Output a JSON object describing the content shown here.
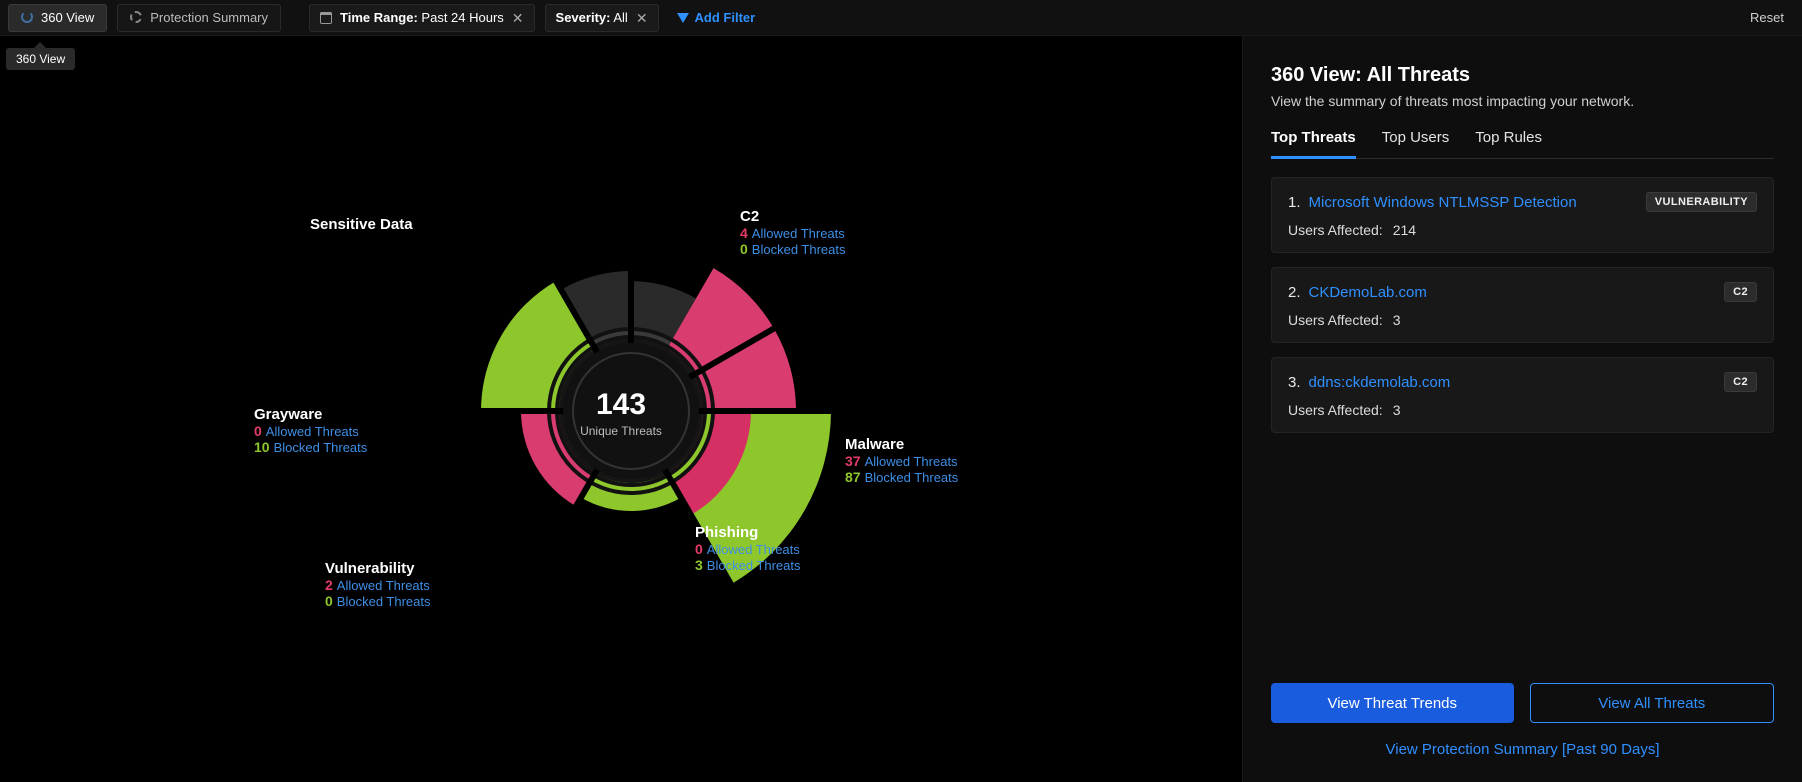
{
  "topbar": {
    "tabs": [
      {
        "label": "360 View",
        "active": true
      },
      {
        "label": "Protection Summary",
        "active": false
      }
    ],
    "filters": [
      {
        "prefix": "Time Range:",
        "value": "Past 24 Hours"
      },
      {
        "prefix": "Severity:",
        "value": "All"
      }
    ],
    "add_filter": "Add Filter",
    "reset": "Reset",
    "tooltip": "360 View"
  },
  "chart": {
    "center_value": "143",
    "center_label": "Unique Threats",
    "categories": {
      "sensitive": {
        "name": "Sensitive Data"
      },
      "c2": {
        "name": "C2",
        "allowed": "4",
        "blocked": "0"
      },
      "malware": {
        "name": "Malware",
        "allowed": "37",
        "blocked": "87"
      },
      "phishing": {
        "name": "Phishing",
        "allowed": "0",
        "blocked": "3"
      },
      "vulnerability": {
        "name": "Vulnerability",
        "allowed": "2",
        "blocked": "0"
      },
      "grayware": {
        "name": "Grayware",
        "allowed": "0",
        "blocked": "10"
      }
    },
    "labels": {
      "allowed": "Allowed Threats",
      "blocked": "Blocked Threats"
    }
  },
  "panel": {
    "title": "360 View: All Threats",
    "subtitle": "View the summary of threats most impacting your network.",
    "tabs": [
      "Top Threats",
      "Top Users",
      "Top Rules"
    ],
    "active_tab": 0,
    "threats": [
      {
        "idx": "1.",
        "name": "Microsoft Windows NTLMSSP Detection",
        "badge": "VULNERABILITY",
        "users_label": "Users Affected:",
        "users": "214"
      },
      {
        "idx": "2.",
        "name": "CKDemoLab.com",
        "badge": "C2",
        "users_label": "Users Affected:",
        "users": "3"
      },
      {
        "idx": "3.",
        "name": "ddns:ckdemolab.com",
        "badge": "C2",
        "users_label": "Users Affected:",
        "users": "3"
      }
    ],
    "btn_primary": "View Threat Trends",
    "btn_outline": "View All Threats",
    "footer_link": "View Protection Summary [Past 90 Days]"
  },
  "chart_data": {
    "type": "pie",
    "title": "Unique Threats",
    "center_value": 143,
    "series": [
      {
        "name": "Allowed Threats",
        "color": "#e43c66",
        "values": {
          "Sensitive Data": null,
          "C2": 4,
          "Malware": 37,
          "Phishing": 0,
          "Vulnerability": 2,
          "Grayware": 0
        }
      },
      {
        "name": "Blocked Threats",
        "color": "#8ec72b",
        "values": {
          "Sensitive Data": null,
          "C2": 0,
          "Malware": 87,
          "Phishing": 3,
          "Vulnerability": 0,
          "Grayware": 10
        }
      }
    ],
    "categories": [
      "Sensitive Data",
      "C2",
      "Malware",
      "Phishing",
      "Vulnerability",
      "Grayware"
    ],
    "note": "Radial length of each wedge encodes count; color encodes allowed (pink) vs blocked (green). Sensitive Data shown as dark wedge (no data)."
  }
}
